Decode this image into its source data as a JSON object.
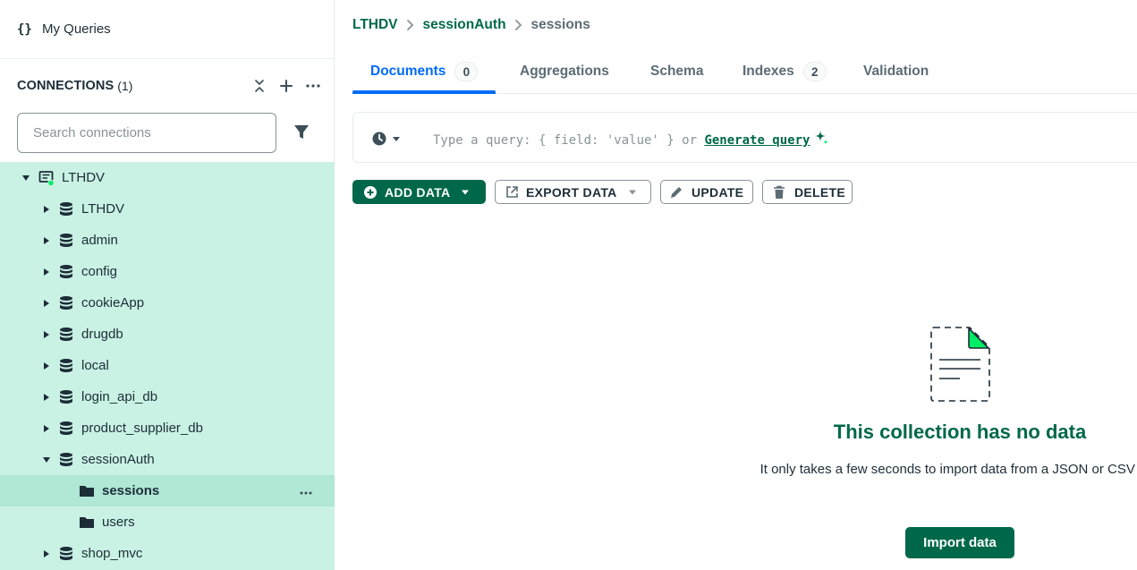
{
  "sidebar": {
    "my_queries_label": "My Queries",
    "connections_title": "CONNECTIONS",
    "connections_count": "(1)",
    "search_placeholder": "Search connections",
    "tree": {
      "connection": "LTHDV",
      "databases": [
        {
          "label": "LTHDV",
          "expanded": false
        },
        {
          "label": "admin",
          "expanded": false
        },
        {
          "label": "config",
          "expanded": false
        },
        {
          "label": "cookieApp",
          "expanded": false
        },
        {
          "label": "drugdb",
          "expanded": false
        },
        {
          "label": "local",
          "expanded": false
        },
        {
          "label": "login_api_db",
          "expanded": false
        },
        {
          "label": "product_supplier_db",
          "expanded": false
        },
        {
          "label": "sessionAuth",
          "expanded": true
        },
        {
          "label": "shop_mvc",
          "expanded": false
        }
      ],
      "collections": [
        {
          "label": "sessions",
          "selected": true
        },
        {
          "label": "users",
          "selected": false
        }
      ]
    }
  },
  "breadcrumb": {
    "connection": "LTHDV",
    "database": "sessionAuth",
    "collection": "sessions"
  },
  "tabs": [
    {
      "label": "Documents",
      "badge": "0",
      "active": true
    },
    {
      "label": "Aggregations",
      "badge": null,
      "active": false
    },
    {
      "label": "Schema",
      "badge": null,
      "active": false
    },
    {
      "label": "Indexes",
      "badge": "2",
      "active": false
    },
    {
      "label": "Validation",
      "badge": null,
      "active": false
    }
  ],
  "query_bar": {
    "placeholder": "Type a query: { field: 'value' } or",
    "generate_link": "Generate query"
  },
  "toolbar": {
    "add_data": "ADD DATA",
    "export_data": "EXPORT DATA",
    "update": "UPDATE",
    "delete": "DELETE"
  },
  "empty_state": {
    "title": "This collection has no data",
    "subtitle": "It only takes a few seconds to import data from a JSON or CSV file.",
    "import_button": "Import data"
  },
  "colors": {
    "accent_green": "#00684a",
    "tree_bg": "#c9f2e4",
    "tree_selected_bg": "#b0e7d5",
    "tab_active": "#016bf8",
    "status_dot": "#00ed64"
  }
}
